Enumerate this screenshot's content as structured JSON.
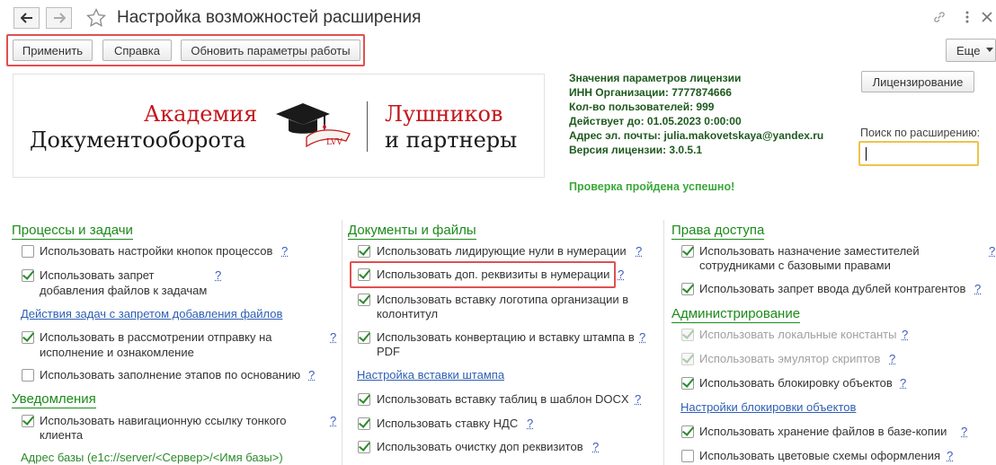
{
  "header": {
    "title": "Настройка возможностей расширения",
    "back_icon": "arrow-left-icon",
    "forward_icon": "arrow-right-icon",
    "favorite_icon": "star-icon",
    "link_icon": "link-icon",
    "menu_icon": "vertical-dots-icon",
    "close_icon": "close-icon"
  },
  "toolbar": {
    "apply_label": "Применить",
    "help_label": "Справка",
    "refresh_label": "Обновить параметры работы",
    "more_label": "Еще"
  },
  "logo": {
    "line1_red": "Академия",
    "line1_black": "Документооборота",
    "line2_red": "Лушников",
    "line2_black": "и партнеры",
    "seal_text": "LVV"
  },
  "license": {
    "heading": "Значения параметров лицензии",
    "inn": "ИНН Организации: 7777874666",
    "users": "Кол-во пользователей: 999",
    "valid_until": "Действует до: 01.05.2023 0:00:00",
    "email": "Адрес эл. почты: julia.makovetskaya@yandex.ru",
    "version": "Версия лицензии: 3.0.5.1",
    "status": "Проверка пройдена успешно!",
    "licensing_button": "Лицензирование"
  },
  "search": {
    "label": "Поиск по расширению:",
    "value": ""
  },
  "help_mark": "?",
  "col1": {
    "processes_title": "Процессы и задачи",
    "item1": "Использовать настройки кнопок процессов",
    "item2_l1": "Использовать запрет",
    "item2_l2": "добавления файлов к задачам",
    "link1": "Действия задач с запретом добавления файлов",
    "item3_l1": "Использовать в рассмотрении отправку на",
    "item3_l2": "исполнение и ознакомление",
    "item4": "Использовать заполнение этапов по основанию",
    "notif_title": "Уведомления",
    "item5_l1": "Использовать навигационную ссылку тонкого",
    "item5_l2": "клиента",
    "db_address": "Адрес базы (e1c://server/<Сервер>/<Имя базы>)"
  },
  "col2": {
    "docs_title": "Документы и файлы",
    "item1": "Использовать лидирующие нули в нумерации",
    "item2": "Использовать доп. реквизиты в нумерации",
    "item3_l1": "Использовать вставку логотипа организации в",
    "item3_l2": "колонтитул",
    "item4_l1": "Использовать конвертацию и вставку штампа в",
    "item4_l2": "PDF",
    "link1": "Настройка вставки штампа",
    "item5": "Использовать вставку таблиц в шаблон DOCX",
    "item6": "Использовать ставку НДС",
    "item7": "Использовать очистку доп реквизитов"
  },
  "col3": {
    "rights_title": "Права доступа",
    "item1_l1": "Использовать назначение заместителей",
    "item1_l2": "сотрудниками с базовыми правами",
    "item2": "Использовать запрет ввода дублей контрагентов",
    "admin_title": "Администрирование",
    "item3": "Использовать локальные константы",
    "item4": "Использовать эмулятор скриптов",
    "item5": "Использовать блокировку объектов",
    "link1": "Настройки блокировки объектов",
    "item6": "Использовать хранение файлов в базе-копии",
    "item7": "Использовать цветовые схемы оформления"
  },
  "colors": {
    "accent_green": "#1b8a1b",
    "highlight_red": "#e05050",
    "link_blue": "#2e5fb4",
    "logo_red": "#c4161c"
  }
}
